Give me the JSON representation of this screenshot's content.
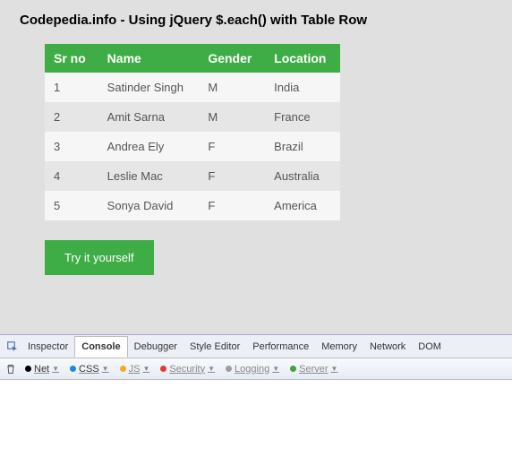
{
  "page": {
    "title": "Codepedia.info - Using jQuery $.each() with Table Row",
    "try_button": "Try it yourself"
  },
  "table": {
    "headers": [
      "Sr no",
      "Name",
      "Gender",
      "Location"
    ],
    "rows": [
      [
        "1",
        "Satinder Singh",
        "M",
        "India"
      ],
      [
        "2",
        "Amit Sarna",
        "M",
        "France"
      ],
      [
        "3",
        "Andrea Ely",
        "F",
        "Brazil"
      ],
      [
        "4",
        "Leslie Mac",
        "F",
        "Australia"
      ],
      [
        "5",
        "Sonya David",
        "F",
        "America"
      ]
    ]
  },
  "devtools": {
    "tabs": [
      "Inspector",
      "Console",
      "Debugger",
      "Style Editor",
      "Performance",
      "Memory",
      "Network",
      "DOM"
    ],
    "active_tab": "Console",
    "filters": [
      {
        "label": "Net",
        "color": "#000000",
        "active": true
      },
      {
        "label": "CSS",
        "color": "#1e88e5",
        "active": true
      },
      {
        "label": "JS",
        "color": "#f9a825",
        "active": false
      },
      {
        "label": "Security",
        "color": "#e53935",
        "active": false
      },
      {
        "label": "Logging",
        "color": "#9e9e9e",
        "active": false
      },
      {
        "label": "Server",
        "color": "#43a047",
        "active": false
      }
    ]
  }
}
